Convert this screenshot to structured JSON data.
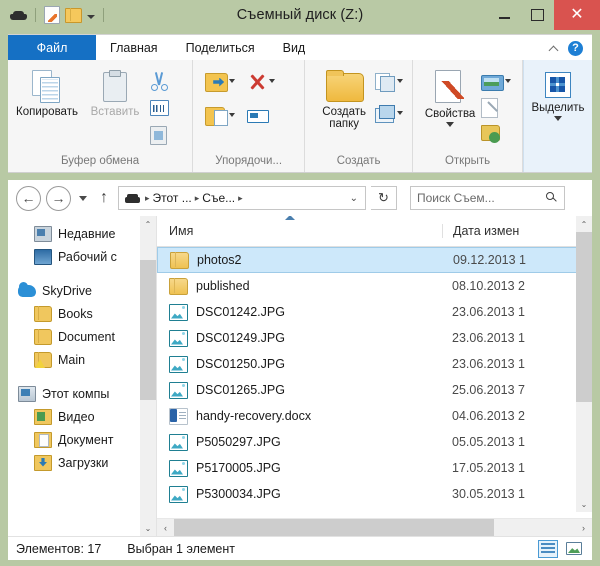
{
  "window": {
    "title": "Съемный диск (Z:)",
    "titlebar_color": "#b9c9a5",
    "close_color": "#d9534f",
    "accent_color": "#1570c4"
  },
  "quick_access": {
    "items": [
      {
        "name": "drive-icon",
        "label": "Съемный диск"
      },
      {
        "name": "properties-icon",
        "label": "Свойства"
      },
      {
        "name": "new-folder-icon",
        "label": "Создать папку"
      }
    ],
    "dropdown_label": "Настроить панель быстрого доступа"
  },
  "window_controls": {
    "minimize": "—",
    "maximize": "□",
    "close": "✕"
  },
  "ribbon": {
    "tabs": [
      {
        "label": "Файл",
        "active": false,
        "is_file": true
      },
      {
        "label": "Главная",
        "active": true,
        "is_file": false
      },
      {
        "label": "Поделиться",
        "active": false,
        "is_file": false
      },
      {
        "label": "Вид",
        "active": false,
        "is_file": false
      }
    ],
    "collapse_label": "^",
    "help_label": "?",
    "groups": [
      {
        "label": "Буфер обмена",
        "big_buttons": [
          {
            "label": "Копировать",
            "icon": "copy-icon",
            "enabled": true
          },
          {
            "label": "Вставить",
            "icon": "paste-icon",
            "enabled": false
          }
        ],
        "small_buttons": [
          {
            "icon": "cut-icon",
            "label": "Вырезать"
          },
          {
            "icon": "copy-path-icon",
            "label": "Скопировать путь"
          },
          {
            "icon": "paste-shortcut-icon",
            "label": "Вставить ярлык"
          }
        ]
      },
      {
        "label": "Упорядочи...",
        "small_buttons": [
          {
            "icon": "move-to-icon",
            "label": "Переместить в",
            "caret": true
          },
          {
            "icon": "delete-icon",
            "label": "Удалить",
            "caret": true
          },
          {
            "icon": "copy-to-icon",
            "label": "Копировать в",
            "caret": true
          },
          {
            "icon": "rename-icon",
            "label": "Переименовать",
            "caret": false
          }
        ]
      },
      {
        "label": "Создать",
        "big_buttons": [
          {
            "label": "Создать папку",
            "icon": "new-folder-icon",
            "enabled": true
          }
        ],
        "small_buttons": [
          {
            "icon": "new-item-icon",
            "label": "Создать элемент",
            "caret": true
          },
          {
            "icon": "easy-access-icon",
            "label": "Простой доступ",
            "caret": true
          }
        ]
      },
      {
        "label": "Открыть",
        "big_buttons": [
          {
            "label": "Свойства",
            "icon": "properties-icon",
            "enabled": true,
            "caret": true
          }
        ],
        "small_buttons": [
          {
            "icon": "open-icon",
            "label": "Открыть",
            "caret": true
          },
          {
            "icon": "edit-icon",
            "label": "Изменить",
            "caret": false
          },
          {
            "icon": "history-icon",
            "label": "Журнал",
            "caret": false
          }
        ]
      },
      {
        "label": "",
        "big_buttons": [
          {
            "label": "Выделить",
            "icon": "select-icon",
            "enabled": true,
            "caret": true
          }
        ]
      }
    ]
  },
  "address_bar": {
    "back_label": "←",
    "forward_label": "→",
    "history_label": "▾",
    "up_label": "↑",
    "breadcrumbs": [
      "Этот ...",
      "Съе..."
    ],
    "separator": "▸",
    "dropdown_label": "⌄",
    "refresh_label": "↻"
  },
  "search": {
    "placeholder": "Поиск Съем...",
    "icon": "search-icon"
  },
  "nav_pane": {
    "items": [
      {
        "label": "Недавние",
        "icon": "recent-icon",
        "level": "child",
        "spacer_before": false
      },
      {
        "label": "Рабочий с",
        "icon": "desktop-icon",
        "level": "child",
        "spacer_before": false
      },
      {
        "label": "SkyDrive",
        "icon": "skydrive-icon",
        "level": "root",
        "spacer_before": true
      },
      {
        "label": "Books",
        "icon": "folder-icon",
        "level": "child",
        "spacer_before": false
      },
      {
        "label": "Document",
        "icon": "folder-icon",
        "level": "child",
        "spacer_before": false
      },
      {
        "label": "Main",
        "icon": "folder-warn-icon",
        "level": "child",
        "spacer_before": false
      },
      {
        "label": "Этот компы",
        "icon": "this-pc-icon",
        "level": "root",
        "spacer_before": true
      },
      {
        "label": "Видео",
        "icon": "video-folder-icon",
        "level": "child",
        "spacer_before": false
      },
      {
        "label": "Документ",
        "icon": "documents-folder-icon",
        "level": "child",
        "spacer_before": false
      },
      {
        "label": "Загрузки",
        "icon": "downloads-folder-icon",
        "level": "child",
        "spacer_before": false
      }
    ],
    "scroll_up": "⌃",
    "scroll_down": "⌄"
  },
  "file_list": {
    "columns": [
      {
        "key": "name",
        "label": "Имя",
        "sorted": true
      },
      {
        "key": "date",
        "label": "Дата измен"
      }
    ],
    "rows": [
      {
        "name": "photos2",
        "date": "09.12.2013 1",
        "icon": "folder-icon",
        "selected": true
      },
      {
        "name": "published",
        "date": "08.10.2013 2",
        "icon": "folder-icon",
        "selected": false
      },
      {
        "name": "DSC01242.JPG",
        "date": "23.06.2013 1",
        "icon": "jpg-file-icon",
        "selected": false
      },
      {
        "name": "DSC01249.JPG",
        "date": "23.06.2013 1",
        "icon": "jpg-file-icon",
        "selected": false
      },
      {
        "name": "DSC01250.JPG",
        "date": "23.06.2013 1",
        "icon": "jpg-file-icon",
        "selected": false
      },
      {
        "name": "DSC01265.JPG",
        "date": "25.06.2013 7",
        "icon": "jpg-file-icon",
        "selected": false
      },
      {
        "name": "handy-recovery.docx",
        "date": "04.06.2013 2",
        "icon": "docx-file-icon",
        "selected": false
      },
      {
        "name": "P5050297.JPG",
        "date": "05.05.2013 1",
        "icon": "jpg-file-icon",
        "selected": false
      },
      {
        "name": "P5170005.JPG",
        "date": "17.05.2013 1",
        "icon": "jpg-file-icon",
        "selected": false
      },
      {
        "name": "P5300034.JPG",
        "date": "30.05.2013 1",
        "icon": "jpg-file-icon",
        "selected": false
      }
    ],
    "scroll_up": "⌃",
    "scroll_down": "⌄",
    "scroll_left": "‹",
    "scroll_right": "›"
  },
  "status_bar": {
    "item_count": "Элементов: 17",
    "selection": "Выбран 1 элемент",
    "view_buttons": [
      {
        "name": "details-view-button",
        "label": "Таблица",
        "active": true
      },
      {
        "name": "large-icons-view-button",
        "label": "Крупные значки",
        "active": false
      }
    ]
  }
}
